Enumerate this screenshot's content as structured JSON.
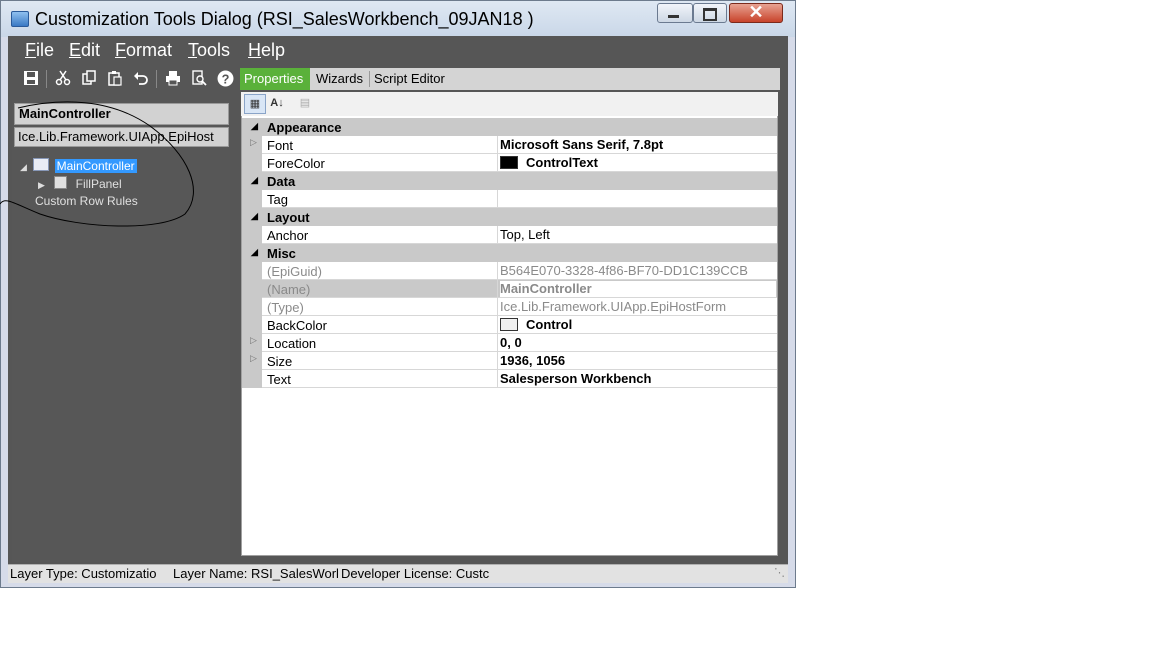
{
  "window": {
    "title": "Customization Tools Dialog  (RSI_SalesWorkbench_09JAN18 )",
    "close_glyph": "✕"
  },
  "menu": [
    {
      "label": "File",
      "underline": "F",
      "rest": "ile"
    },
    {
      "label": "Edit",
      "underline": "E",
      "rest": "dit"
    },
    {
      "label": "Format",
      "underline": "F",
      "rest": "ormat"
    },
    {
      "label": "Tools",
      "underline": "T",
      "rest": "ools"
    },
    {
      "label": "Help",
      "underline": "H",
      "rest": "elp"
    }
  ],
  "toolbar": {
    "icons": [
      "save-icon",
      "cut-icon",
      "copy-icon",
      "paste-icon",
      "undo-icon",
      "print-icon",
      "print-preview-icon",
      "help-icon"
    ]
  },
  "tabs": [
    {
      "label": "Properties",
      "active": true
    },
    {
      "label": "Wizards",
      "active": false
    },
    {
      "label": "Script Editor",
      "active": false
    }
  ],
  "left_panel": {
    "selected_control": "MainController",
    "control_type": "Ice.Lib.Framework.UIApp.EpiHost",
    "tree": {
      "root": "MainController",
      "child": "FillPanel",
      "extra": "Custom Row Rules"
    }
  },
  "property_grid": {
    "categories": [
      {
        "name": "Appearance",
        "props": [
          {
            "name": "Font",
            "value": "Microsoft Sans Serif, 7.8pt",
            "expandable": true,
            "bold": true
          },
          {
            "name": "ForeColor",
            "value": "ControlText",
            "swatch": "#000000",
            "bold": true
          }
        ]
      },
      {
        "name": "Data",
        "props": [
          {
            "name": "Tag",
            "value": ""
          }
        ]
      },
      {
        "name": "Layout",
        "props": [
          {
            "name": "Anchor",
            "value": "Top, Left"
          }
        ]
      },
      {
        "name": "Misc",
        "props": [
          {
            "name": "(EpiGuid)",
            "value": "B564E070-3328-4f86-BF70-DD1C139CCB",
            "dim": true
          },
          {
            "name": "(Name)",
            "value": "MainController",
            "dim": true,
            "bold": true,
            "selected": true
          },
          {
            "name": "(Type)",
            "value": "Ice.Lib.Framework.UIApp.EpiHostForm",
            "dim": true
          },
          {
            "name": "BackColor",
            "value": "Control",
            "swatch": "#f0f0f0",
            "bold": true
          },
          {
            "name": "Location",
            "value": "0, 0",
            "expandable": true,
            "bold": true
          },
          {
            "name": "Size",
            "value": "1936, 1056",
            "expandable": true,
            "bold": true
          },
          {
            "name": "Text",
            "value": "Salesperson Workbench",
            "bold": true
          }
        ]
      }
    ]
  },
  "status": {
    "layer_type": "Layer Type:  Customizatio",
    "layer_name": "Layer Name:  RSI_SalesWorkb",
    "license": "Developer License:  Custc"
  },
  "colors": {
    "active_tab": "#5ab13a",
    "frame": "#565656"
  }
}
